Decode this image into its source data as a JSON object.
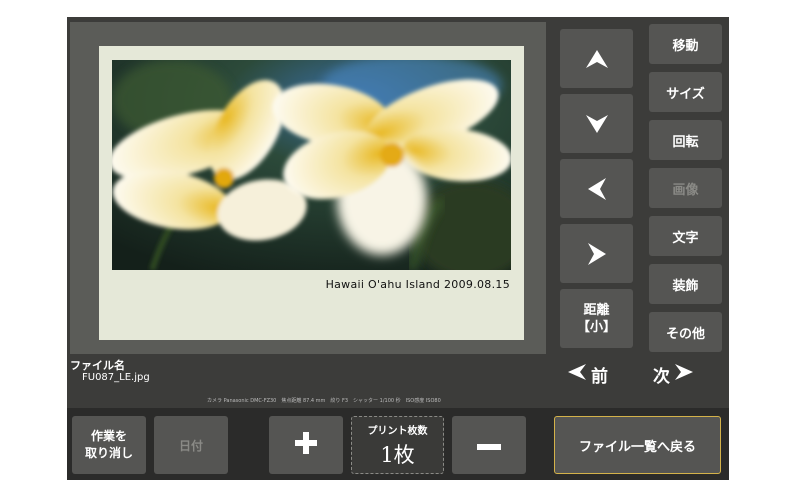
{
  "preview": {
    "caption": "Hawaii O'ahu Island  2009.08.15"
  },
  "side_menu": {
    "move": "移動",
    "size": "サイズ",
    "rotate": "回転",
    "image": "画像",
    "text": "文字",
    "decoration": "装飾",
    "other": "その他"
  },
  "nav_pad": {
    "up_icon": "arrow-up-icon",
    "down_icon": "arrow-down-icon",
    "left_icon": "arrow-left-icon",
    "right_icon": "arrow-right-icon",
    "distance_line1": "距離",
    "distance_line2": "【小】"
  },
  "file": {
    "label": "ファイル名",
    "name": "FU087_LE.jpg",
    "exif": "カメラ Panasonic DMC-FZ30　焦点距離 87.4 mm　絞り F3　シャッター 1/100 秒　ISO感度 ISO80"
  },
  "paging": {
    "prev": "前",
    "next": "次"
  },
  "bottom": {
    "undo_line1": "作業を",
    "undo_line2": "取り消し",
    "date": "日付",
    "print_count_label": "プリント枚数",
    "print_count_value": "1枚",
    "back_to_list": "ファイル一覧へ戻る"
  },
  "colors": {
    "background": "#3c3c3a",
    "button": "#555553",
    "accent_border": "#d4b24a",
    "paper": "#e5e8d8"
  }
}
